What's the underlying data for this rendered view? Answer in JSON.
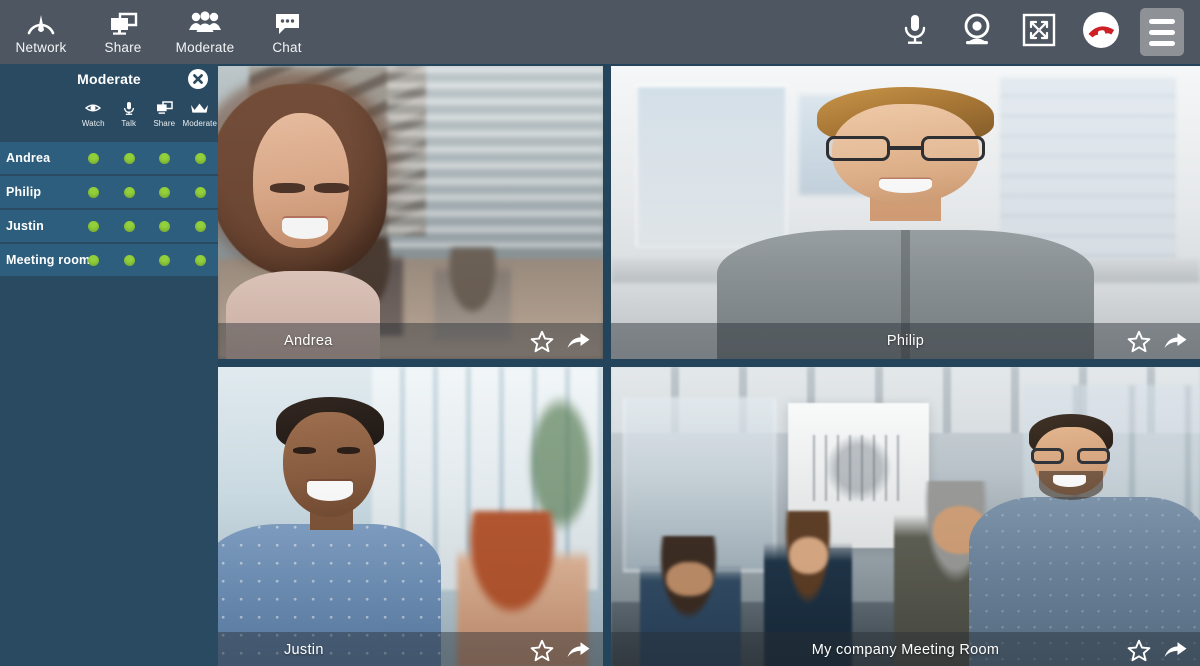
{
  "toolbar": {
    "left_buttons": [
      {
        "label": "Network",
        "icon": "network-gauge-icon"
      },
      {
        "label": "Share",
        "icon": "screen-share-icon"
      },
      {
        "label": "Moderate",
        "icon": "people-group-icon"
      },
      {
        "label": "Chat",
        "icon": "chat-bubble-icon"
      }
    ],
    "right_buttons": [
      {
        "name": "microphone",
        "icon": "microphone-icon"
      },
      {
        "name": "webcam",
        "icon": "webcam-icon"
      },
      {
        "name": "fullscreen",
        "icon": "fullscreen-expand-icon"
      },
      {
        "name": "hangup",
        "icon": "hangup-phone-icon"
      },
      {
        "name": "menu",
        "icon": "hamburger-menu-icon"
      }
    ],
    "background": "#4e5761"
  },
  "sidebar": {
    "title": "Moderate",
    "close_icon": "close-circle-icon",
    "background": "#2a4a61",
    "row_background": "#2e5e7d",
    "status_color": "#93d13c",
    "columns": [
      {
        "label": "Watch",
        "icon": "eye-icon"
      },
      {
        "label": "Talk",
        "icon": "microphone-icon"
      },
      {
        "label": "Share",
        "icon": "screen-share-icon"
      },
      {
        "label": "Moderate",
        "icon": "crown-icon"
      }
    ],
    "participants": [
      {
        "name": "Andrea",
        "watch": "on",
        "talk": "on",
        "share": "on",
        "moderate": "on"
      },
      {
        "name": "Philip",
        "watch": "on",
        "talk": "on",
        "share": "on",
        "moderate": "on"
      },
      {
        "name": "Justin",
        "watch": "on",
        "talk": "on",
        "share": "on",
        "moderate": "on"
      },
      {
        "name": "Meeting room",
        "watch": "on",
        "talk": "on",
        "share": "on",
        "moderate": "on"
      }
    ]
  },
  "video_grid": {
    "background": "#24445c",
    "tiles": [
      {
        "name": "Andrea",
        "label_align": "left",
        "favorite_icon": "star-outline-icon",
        "share_icon": "share-arrow-icon"
      },
      {
        "name": "Philip",
        "label_align": "center",
        "favorite_icon": "star-outline-icon",
        "share_icon": "share-arrow-icon"
      },
      {
        "name": "Justin",
        "label_align": "left",
        "favorite_icon": "star-outline-icon",
        "share_icon": "share-arrow-icon"
      },
      {
        "name": "My company Meeting Room",
        "label_align": "center",
        "favorite_icon": "star-outline-icon",
        "share_icon": "share-arrow-icon"
      }
    ]
  }
}
